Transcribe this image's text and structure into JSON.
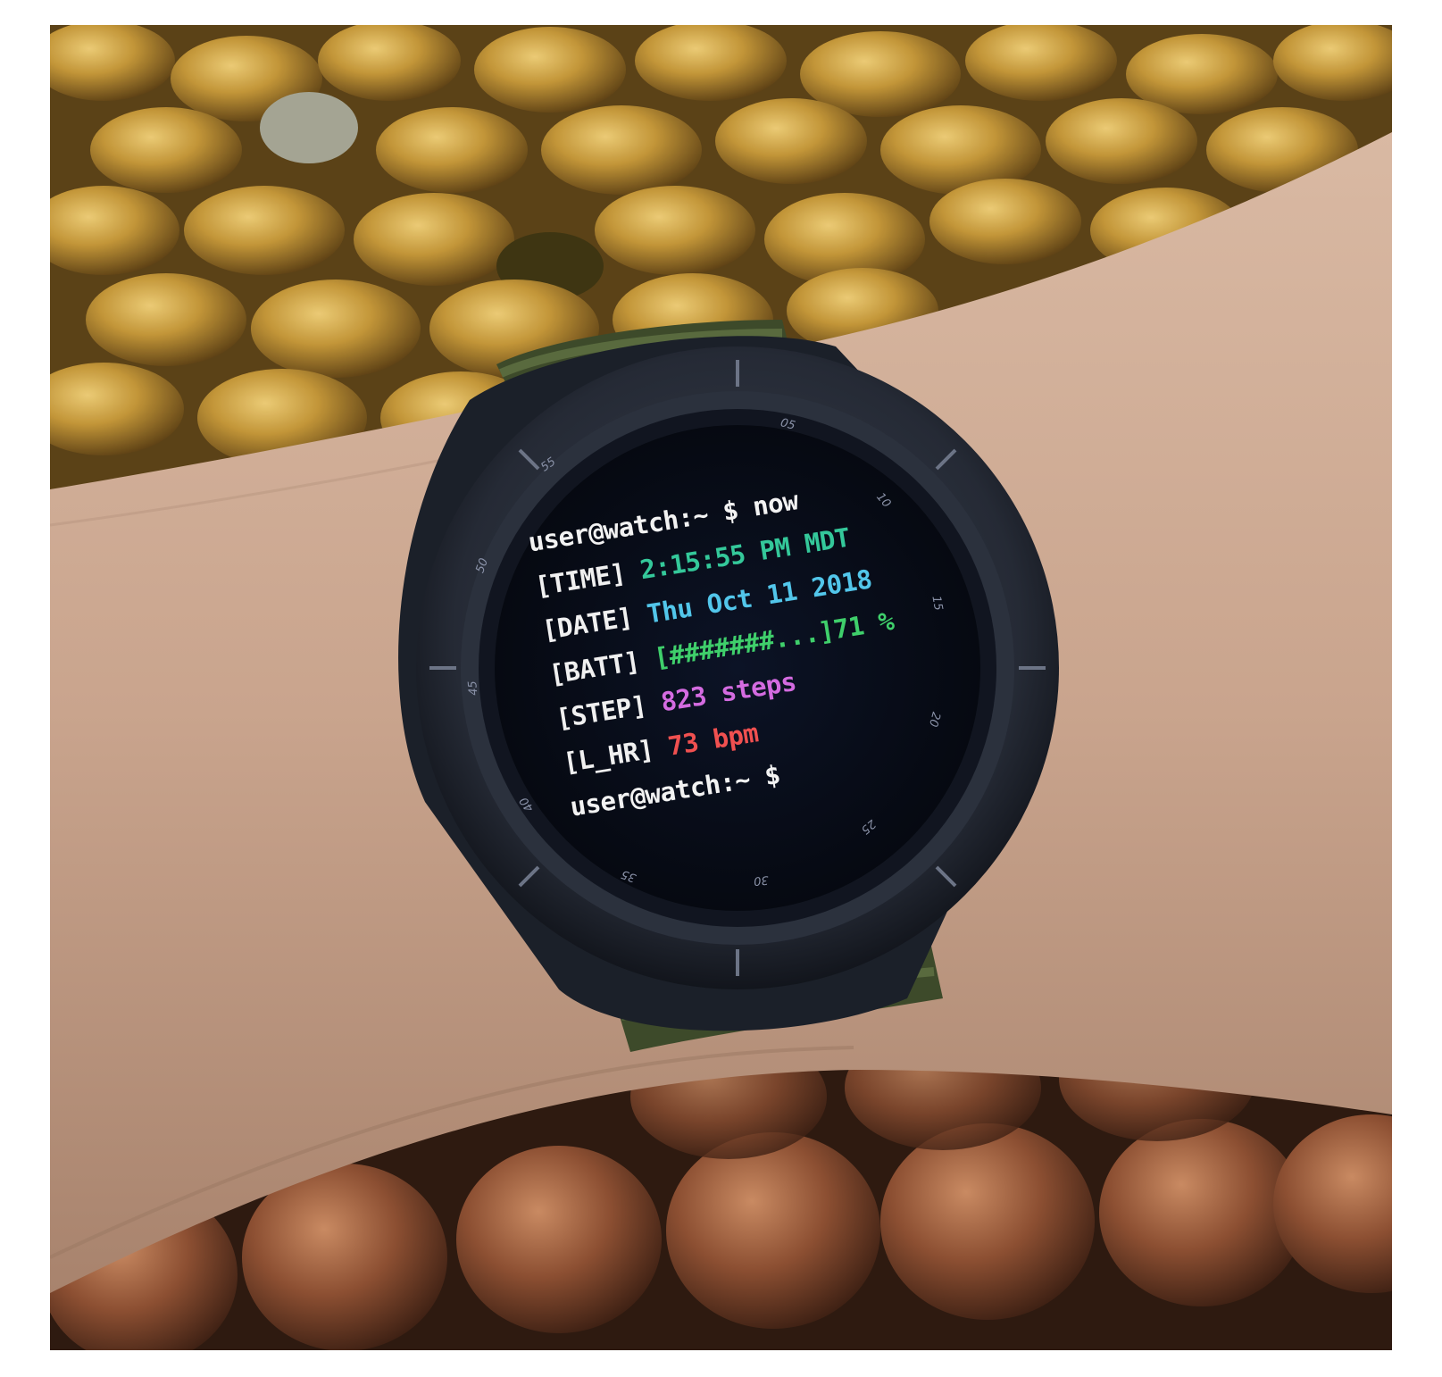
{
  "terminal": {
    "prompt1": "user@watch:~ $ now",
    "time_tag": "[TIME]",
    "time_value": "2:15:55 PM MDT",
    "date_tag": "[DATE]",
    "date_value": "Thu Oct 11 2018",
    "batt_tag": "[BATT]",
    "batt_value": "[#######...]71 %",
    "step_tag": "[STEP]",
    "step_value": "823 steps",
    "hr_tag": "[L_HR]",
    "hr_value": "73 bpm",
    "prompt2": "user@watch:~ $"
  },
  "bezel": {
    "n55": "55",
    "n05": "05",
    "n10": "10",
    "n15": "15",
    "n20": "20",
    "n25": "25",
    "n30": "30",
    "n35": "35",
    "n40": "40",
    "n45": "45",
    "n50": "50"
  },
  "colors": {
    "time": "#34c89a",
    "date": "#52c6ea",
    "batt": "#3fcf6b",
    "step": "#d46be0",
    "hr": "#f05050"
  }
}
